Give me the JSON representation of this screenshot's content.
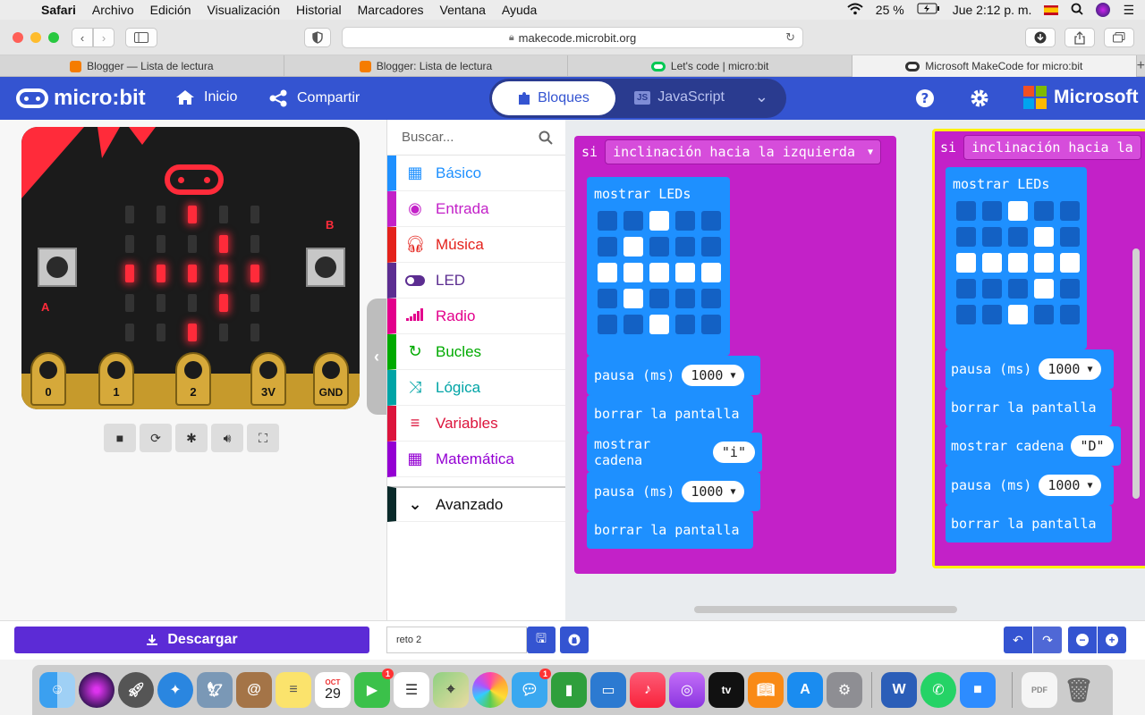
{
  "menubar": {
    "app": "Safari",
    "items": [
      "Archivo",
      "Edición",
      "Visualización",
      "Historial",
      "Marcadores",
      "Ventana",
      "Ayuda"
    ],
    "battery": "25 %",
    "datetime": "Jue 2:12 p. m."
  },
  "browser": {
    "url": "makecode.microbit.org",
    "tabs": [
      {
        "title": "Blogger — Lista de lectura",
        "color": "#f57c00"
      },
      {
        "title": "Blogger: Lista de lectura",
        "color": "#f57c00"
      },
      {
        "title": "Let's code | micro:bit",
        "color": "#00c853"
      },
      {
        "title": "Microsoft MakeCode for micro:bit",
        "color": "#333333"
      }
    ]
  },
  "header": {
    "logo": "micro:bit",
    "home": "Inicio",
    "share": "Compartir",
    "blocks_tab": "Bloques",
    "js_tab": "JavaScript",
    "brand": "Microsoft"
  },
  "simulator": {
    "pins": [
      "0",
      "1",
      "2",
      "3V",
      "GND"
    ],
    "button_a": "A",
    "button_b": "B",
    "led_matrix": [
      [
        0,
        0,
        1,
        0,
        0
      ],
      [
        0,
        0,
        0,
        1,
        0
      ],
      [
        1,
        1,
        1,
        1,
        1
      ],
      [
        0,
        0,
        0,
        1,
        0
      ],
      [
        0,
        0,
        1,
        0,
        0
      ]
    ]
  },
  "toolbox": {
    "search_placeholder": "Buscar...",
    "categories": [
      {
        "label": "Básico",
        "color": "#1e90ff",
        "icon": "grid-icon"
      },
      {
        "label": "Entrada",
        "color": "#c321c8",
        "icon": "target-icon"
      },
      {
        "label": "Música",
        "color": "#e4221c",
        "icon": "headphones-icon"
      },
      {
        "label": "LED",
        "color": "#5c2d91",
        "icon": "toggle-icon"
      },
      {
        "label": "Radio",
        "color": "#e3008c",
        "icon": "signal-icon"
      },
      {
        "label": "Bucles",
        "color": "#00aa00",
        "icon": "loop-icon"
      },
      {
        "label": "Lógica",
        "color": "#00a4a6",
        "icon": "shuffle-icon"
      },
      {
        "label": "Variables",
        "color": "#dc143c",
        "icon": "list-icon"
      },
      {
        "label": "Matemática",
        "color": "#9400d3",
        "icon": "calculator-icon"
      }
    ],
    "advanced": "Avanzado"
  },
  "workspace": {
    "event1": {
      "prefix": "si",
      "condition": "inclinación hacia la izquierda",
      "show_leds": "mostrar LEDs",
      "leds": [
        [
          0,
          0,
          1,
          0,
          0
        ],
        [
          0,
          1,
          0,
          0,
          0
        ],
        [
          1,
          1,
          1,
          1,
          1
        ],
        [
          0,
          1,
          0,
          0,
          0
        ],
        [
          0,
          0,
          1,
          0,
          0
        ]
      ],
      "pause_label": "pausa (ms)",
      "pause_value": "1000",
      "clear": "borrar la pantalla",
      "show_string": "mostrar cadena",
      "string_value": "\"i\"",
      "pause2_value": "1000",
      "clear2": "borrar la pantalla"
    },
    "event2": {
      "prefix": "si",
      "condition": "inclinación hacia la",
      "show_leds": "mostrar LEDs",
      "leds": [
        [
          0,
          0,
          1,
          0,
          0
        ],
        [
          0,
          0,
          0,
          1,
          0
        ],
        [
          1,
          1,
          1,
          1,
          1
        ],
        [
          0,
          0,
          0,
          1,
          0
        ],
        [
          0,
          0,
          1,
          0,
          0
        ]
      ],
      "pause_label": "pausa (ms)",
      "pause_value": "1000",
      "clear": "borrar la pantalla",
      "show_string": "mostrar cadena",
      "string_value": "\"D\"",
      "pause2_value": "1000",
      "clear2": "borrar la pantalla"
    }
  },
  "bottom": {
    "download": "Descargar",
    "project_name": "reto 2"
  },
  "dock": {
    "calendar_month": "OCT",
    "calendar_day": "29",
    "facetime_badge": "1",
    "messages_badge": "1"
  }
}
